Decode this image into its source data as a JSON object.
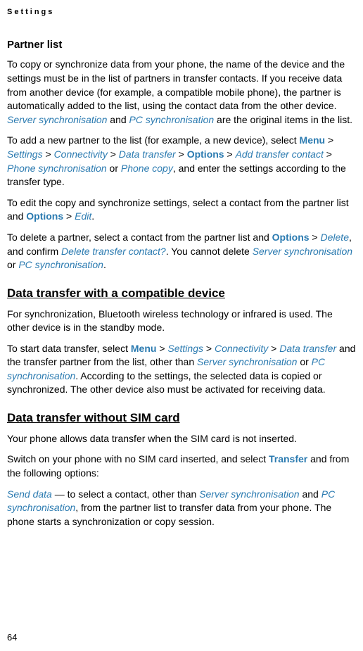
{
  "header": "Settings",
  "s1": {
    "title": "Partner list",
    "p1a": "To copy or synchronize data from your phone, the name of the device and the settings must be in the list of partners in transfer contacts. If you receive data from another device (for example, a compatible mobile phone), the partner is automatically added to the list, using the contact data from the other device. ",
    "server_sync": "Server synchronisation",
    "and1": " and ",
    "pc_sync": "PC synchronisation",
    "p1b": " are the original items in the list.",
    "p2a": "To add a new partner to the list (for example, a new device), select ",
    "menu": "Menu",
    "gt1": " > ",
    "settings": "Settings",
    "gt2": " > ",
    "connectivity": "Connectivity",
    "gt3": " > ",
    "datatransfer": "Data transfer",
    "gt4": " > ",
    "options": "Options",
    "gt5": " > ",
    "addtransfer": "Add transfer contact",
    "gt6": " > ",
    "phonesync": "Phone synchronisation",
    "or1": " or ",
    "phonecopy": "Phone copy",
    "p2b": ", and enter the settings according to the transfer type.",
    "p3a": "To edit the copy and synchronize settings, select a contact from the partner list and ",
    "options2": "Options",
    "gt7": " > ",
    "edit": "Edit",
    "p3b": ".",
    "p4a": "To delete a partner, select a contact from the partner list and ",
    "options3": "Options",
    "gt8": " > ",
    "delete": "Delete",
    "p4b": ", and confirm ",
    "deleteq": "Delete transfer contact?",
    "p4c": ". You cannot delete ",
    "server_sync2": "Server synchronisation",
    "or2": " or ",
    "pc_sync2": "PC synchronisation",
    "p4d": "."
  },
  "s2": {
    "title": "Data transfer with a compatible device",
    "p1": "For synchronization, Bluetooth wireless technology or infrared is used. The other device is in the standby mode.",
    "p2a": "To start data transfer, select ",
    "menu": "Menu",
    "gt1": " > ",
    "settings": "Settings",
    "gt2": " > ",
    "connectivity": "Connectivity",
    "gt3": " > ",
    "datatransfer": "Data transfer",
    "p2b": " and the transfer partner from the list, other than ",
    "server_sync": "Server synchronisation",
    "or1": " or ",
    "pc_sync": "PC synchronisation",
    "p2c": ". According to the settings, the selected data is copied or synchronized. The other device also must be activated for receiving data."
  },
  "s3": {
    "title": "Data transfer without SIM card",
    "p1": "Your phone allows data transfer when the SIM card is not inserted.",
    "p2a": "Switch on your phone with no SIM card inserted, and select ",
    "transfer": "Transfer",
    "p2b": " and from the following options:",
    "senddata": "Send data",
    "p3a": " — to select a contact, other than ",
    "server_sync": "Server synchronisation",
    "and1": " and ",
    "pc_sync": "PC synchronisation",
    "p3b": ", from the partner list to transfer data from your phone. The phone starts a synchronization or copy session."
  },
  "pageNumber": "64"
}
